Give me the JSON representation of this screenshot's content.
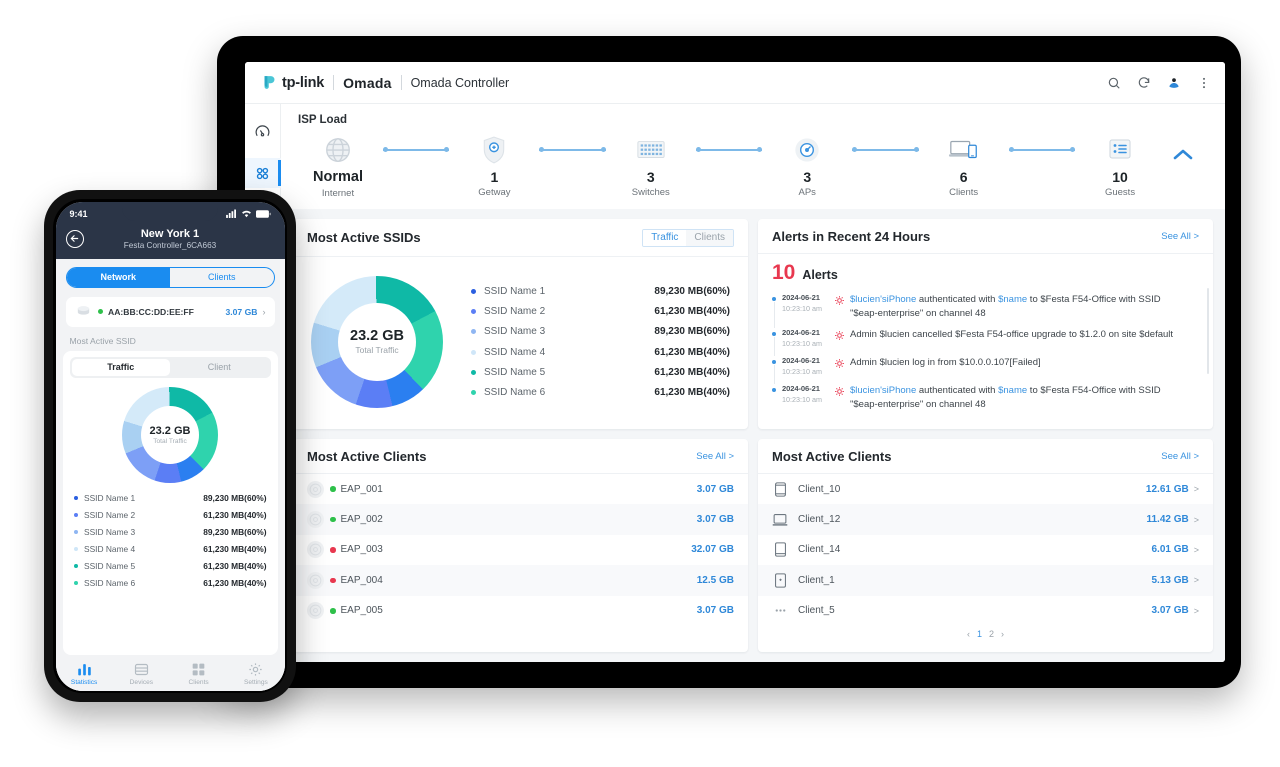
{
  "colors": {
    "accent": "#1a8cf0",
    "link": "#3a93e0",
    "alert_red": "#e8384f",
    "online_green": "#2ec04a",
    "offline_red": "#e8384f",
    "donut": [
      "#0fb9a6",
      "#2b7ff0",
      "#5b7ef5",
      "#6f96f7",
      "#86c2f0",
      "#bfe0f7",
      "#24c0bb"
    ]
  },
  "tablet": {
    "header": {
      "brand_tplink": "tp-link",
      "brand_omada": "Omada",
      "app_title": "Omada Controller",
      "icons": [
        "search-icon",
        "refresh-icon",
        "cloud-user-icon",
        "more-vertical-icon"
      ]
    },
    "rail": [
      {
        "name": "dashboard-gauge",
        "label": "Dashboard",
        "active": false
      },
      {
        "name": "grid-apps",
        "label": "Overview",
        "active": true
      }
    ],
    "isp": {
      "title": "ISP Load",
      "nodes": [
        {
          "icon": "globe-icon",
          "value": "Normal",
          "label": "Internet",
          "is_word": true
        },
        {
          "icon": "shield-icon",
          "value": "1",
          "label": "Getway",
          "is_word": false
        },
        {
          "icon": "switch-icon",
          "value": "3",
          "label": "Switches",
          "is_word": false
        },
        {
          "icon": "ap-icon",
          "value": "3",
          "label": "APs",
          "is_word": false
        },
        {
          "icon": "laptop-icon",
          "value": "6",
          "label": "Clients",
          "is_word": false
        },
        {
          "icon": "clipboard-icon",
          "value": "10",
          "label": "Guests",
          "is_word": false
        }
      ],
      "collapse": "chevron-up-icon"
    },
    "ssid_card": {
      "title": "Most Active SSIDs",
      "tabs": [
        {
          "label": "Traffic",
          "active": true
        },
        {
          "label": "Clients",
          "active": false
        }
      ]
    },
    "alerts_card": {
      "title": "Alerts in Recent 24 Hours",
      "see_all": "See All >",
      "count": "10",
      "count_label": "Alerts",
      "items": [
        {
          "date": "2024-06-21",
          "time": "10:23:10 am",
          "parts": [
            {
              "t": "$lucien'siPhone",
              "blue": true
            },
            {
              "t": " authenticated with ",
              "blue": false
            },
            {
              "t": "$name",
              "blue": true
            },
            {
              "t": " to $Festa F54-Office with SSID \"$eap-enterprise\" on channel 48",
              "blue": false
            }
          ]
        },
        {
          "date": "2024-06-21",
          "time": "10:23:10 am",
          "parts": [
            {
              "t": "Admin $lucien cancelled $Festa F54-office upgrade to $1.2.0 on site $default",
              "blue": false
            }
          ]
        },
        {
          "date": "2024-06-21",
          "time": "10:23:10 am",
          "parts": [
            {
              "t": "Admin $lucien log in from $10.0.0.107[Failed]",
              "blue": false
            }
          ]
        },
        {
          "date": "2024-06-21",
          "time": "10:23:10 am",
          "parts": [
            {
              "t": "$lucien'siPhone",
              "blue": true
            },
            {
              "t": " authenticated with ",
              "blue": false
            },
            {
              "t": "$name",
              "blue": true
            },
            {
              "t": " to $Festa F54-Office with SSID \"$eap-enterprise\" on channel 48",
              "blue": false
            }
          ]
        }
      ]
    },
    "aps_card": {
      "title": "Most Active Clients",
      "see_all": "See All >",
      "rows": [
        {
          "icon": "ap-round-icon",
          "status": "online",
          "name": "EAP_001",
          "value": "3.07 GB"
        },
        {
          "icon": "ap-round-icon",
          "status": "online",
          "name": "EAP_002",
          "value": "3.07 GB"
        },
        {
          "icon": "ap-round-icon",
          "status": "offline",
          "name": "EAP_003",
          "value": "32.07 GB"
        },
        {
          "icon": "ap-round-icon",
          "status": "offline",
          "name": "EAP_004",
          "value": "12.5 GB"
        },
        {
          "icon": "ap-round-icon",
          "status": "online",
          "name": "EAP_005",
          "value": "3.07 GB"
        }
      ]
    },
    "clients_card": {
      "title": "Most Active Clients",
      "see_all": "See All >",
      "rows": [
        {
          "icon": "phone-icon",
          "name": "Client_10",
          "value": "12.61 GB",
          "chevron": ">"
        },
        {
          "icon": "laptop-icon",
          "name": "Client_12",
          "value": "11.42 GB",
          "chevron": ">"
        },
        {
          "icon": "tablet-icon",
          "name": "Client_14",
          "value": "6.01 GB",
          "chevron": ">"
        },
        {
          "icon": "device-icon",
          "name": "Client_1",
          "value": "5.13 GB",
          "chevron": ">"
        },
        {
          "icon": "other-icon",
          "name": "Client_5",
          "value": "3.07 GB",
          "chevron": ">"
        }
      ],
      "pagination": {
        "prev": "‹",
        "pages": [
          "1",
          "2"
        ],
        "current": "1",
        "next": "›"
      }
    }
  },
  "phone": {
    "status_bar": {
      "time": "9:41",
      "icons": [
        "cellular-icon",
        "wifi-icon",
        "battery-icon"
      ]
    },
    "nav": {
      "back_icon": "back-arrow-icon",
      "title": "New York 1",
      "subtitle": "Festa Controller_6CA663"
    },
    "tabs": [
      {
        "label": "Network",
        "active": true
      },
      {
        "label": "Clients",
        "active": false
      }
    ],
    "device": {
      "icon": "ap-stack-icon",
      "status": "online",
      "mac": "AA:BB:CC:DD:EE:FF",
      "value": "3.07 GB",
      "chevron": "›"
    },
    "section_label": "Most Active SSID",
    "seg_tabs": [
      {
        "label": "Traffic",
        "active": true
      },
      {
        "label": "Client",
        "active": false
      }
    ],
    "donut": {
      "value": "23.2 GB",
      "sub": "Total Traffic"
    },
    "tabbar": [
      {
        "icon": "bar-chart-icon",
        "label": "Statistics",
        "active": true
      },
      {
        "icon": "devices-icon",
        "label": "Devices",
        "active": false
      },
      {
        "icon": "clients-grid-icon",
        "label": "Clients",
        "active": false
      },
      {
        "icon": "gear-icon",
        "label": "Settings",
        "active": false
      }
    ]
  },
  "chart_data": {
    "type": "pie",
    "title": "Most Active SSIDs",
    "center_value": "23.2 GB",
    "center_label": "Total Traffic",
    "unit": "MB",
    "categories": [
      "SSID Name 1",
      "SSID Name 2",
      "SSID Name 3",
      "SSID Name 4",
      "SSID Name 5",
      "SSID Name 6"
    ],
    "values": [
      89230,
      61230,
      89230,
      61230,
      61230,
      61230
    ],
    "percent_labels": [
      "60%",
      "40%",
      "60%",
      "40%",
      "40%",
      "40%"
    ],
    "value_labels": [
      "89,230 MB(60%)",
      "61,230 MB(40%)",
      "89,230 MB(60%)",
      "61,230 MB(40%)",
      "61,230 MB(40%)",
      "61,230 MB(40%)"
    ],
    "colors": [
      "#2b5fe0",
      "#5b7ef5",
      "#8fb6f2",
      "#cfe6f8",
      "#0fb9a6",
      "#2fd3ad"
    ],
    "slice_fractions": [
      0.175,
      0.205,
      0.085,
      0.09,
      0.135,
      0.11,
      0.2
    ],
    "legend_position": "right",
    "grid": false
  }
}
